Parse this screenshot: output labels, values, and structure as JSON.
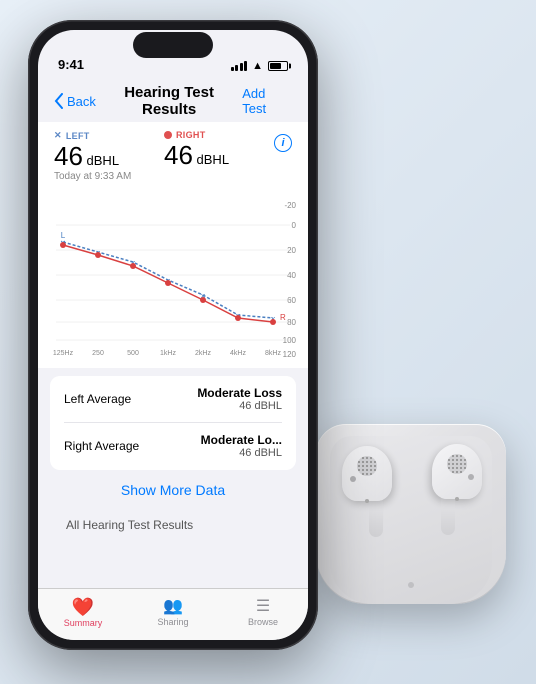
{
  "statusBar": {
    "time": "9:41",
    "batteryLabel": "battery"
  },
  "nav": {
    "backLabel": "Back",
    "title": "Hearing Test Results",
    "addLabel": "Add Test"
  },
  "stats": {
    "leftLabel": "LEFT",
    "rightLabel": "RIGHT",
    "leftValue": "46",
    "leftUnit": " dBHL",
    "rightValue": "46",
    "rightUnit": " dBHL",
    "date": "Today at 9:33 AM"
  },
  "chart": {
    "yAxisLabels": [
      "-20",
      "0",
      "20",
      "40",
      "60",
      "80",
      "100",
      "120"
    ],
    "xAxisLabels": [
      "125Hz",
      "250",
      "500",
      "1kHz",
      "2kHz",
      "4kHz",
      "8kHz"
    ]
  },
  "cards": [
    {
      "label": "Left Average",
      "value": "Moderate Loss",
      "sub": "46 dBHL"
    },
    {
      "label": "Right Average",
      "value": "Moderate Lo...",
      "sub": "46 dBHL"
    }
  ],
  "showMore": "Show More Data",
  "allResults": "All Hearing Test Results",
  "tabs": [
    {
      "label": "Summary",
      "icon": "❤️",
      "active": true
    },
    {
      "label": "Sharing",
      "icon": "👥",
      "active": false
    },
    {
      "label": "Browse",
      "icon": "☰",
      "active": false
    }
  ]
}
